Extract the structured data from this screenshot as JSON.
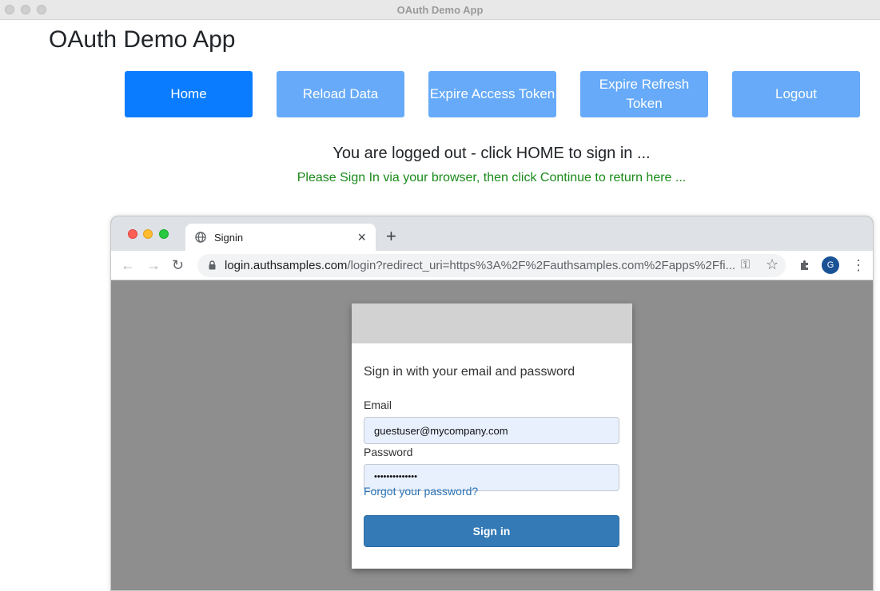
{
  "window": {
    "title": "OAuth Demo App"
  },
  "app": {
    "heading": "OAuth Demo App"
  },
  "nav": {
    "home": "Home",
    "reload": "Reload Data",
    "expire_access": "Expire Access Token",
    "expire_refresh": "Expire Refresh Token",
    "logout": "Logout"
  },
  "status": {
    "message": "You are logged out - click HOME to sign in ...",
    "info": "Please Sign In via your browser, then click Continue to return here ..."
  },
  "browser": {
    "tab_title": "Signin",
    "url_host": "login.authsamples.com",
    "url_path": "/login?redirect_uri=https%3A%2F%2Fauthsamples.com%2Fapps%2Ffi...",
    "profile_initial": "G"
  },
  "login": {
    "title": "Sign in with your email and password",
    "email_label": "Email",
    "email_value": "guestuser@mycompany.com",
    "password_label": "Password",
    "password_value": "••••••••••••••",
    "forgot": "Forgot your password?",
    "submit": "Sign in"
  },
  "colors": {
    "primary_button": "#0a7cff",
    "secondary_button": "#66aaf9",
    "info_text": "#1a8a1a",
    "signin_button": "#337ab7"
  }
}
